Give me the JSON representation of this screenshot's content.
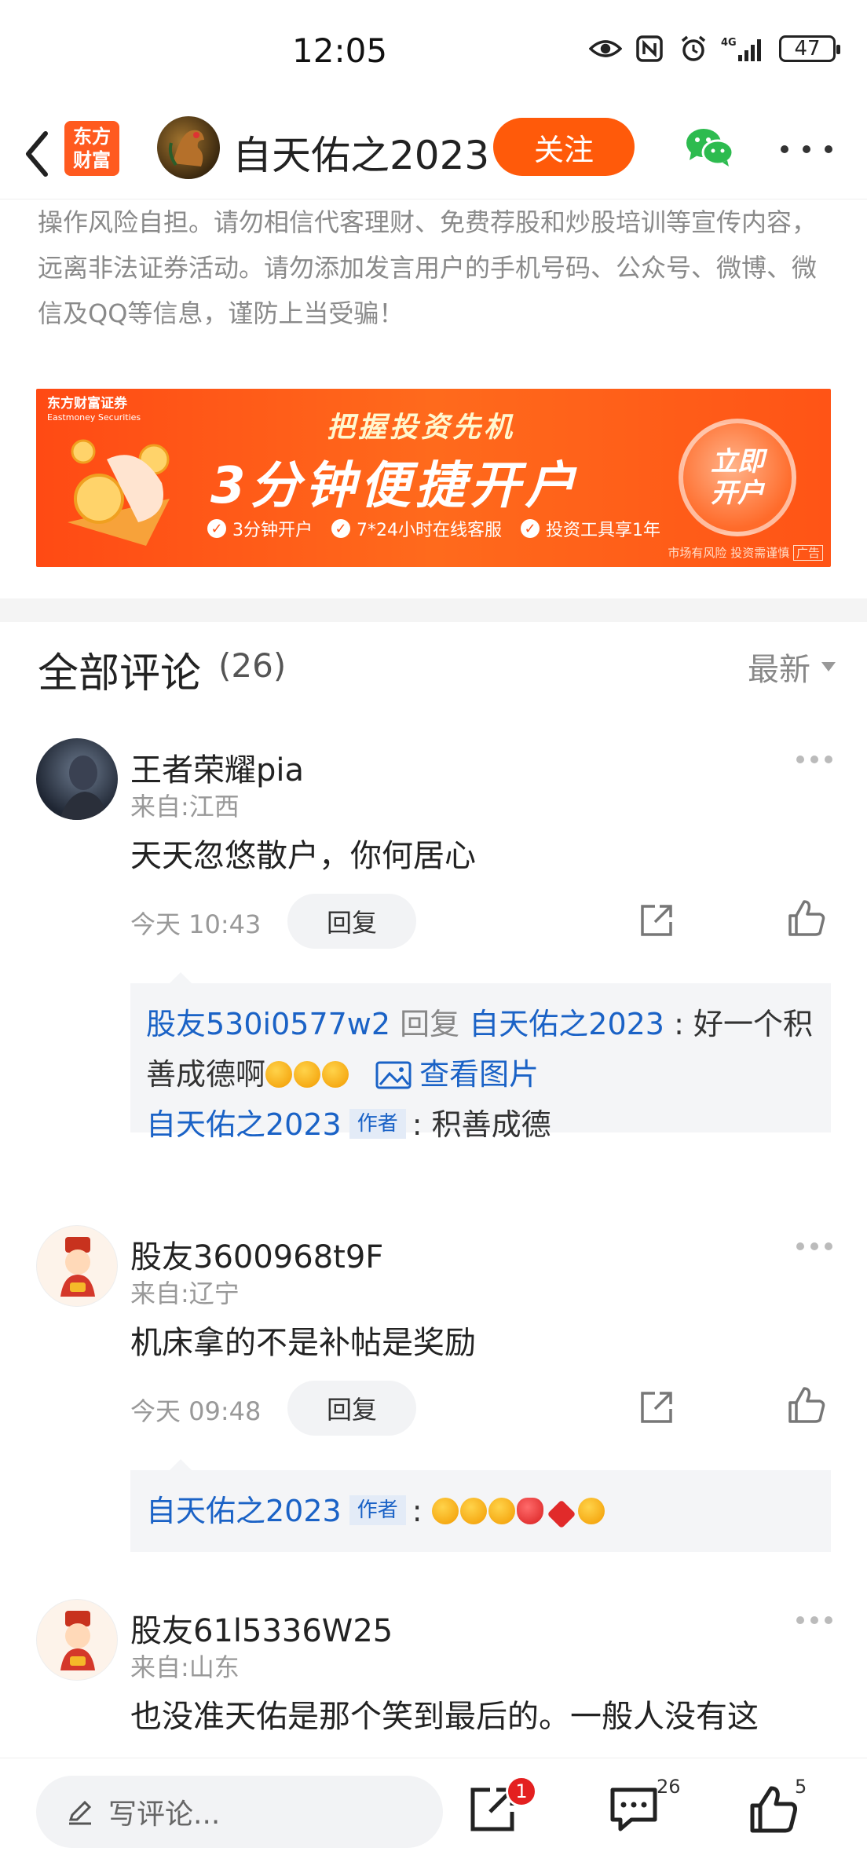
{
  "status_bar": {
    "time": "12:05",
    "network": "4G",
    "battery": "47"
  },
  "header": {
    "brand_logo": "东方\n财富",
    "author_name": "自天佑之2023",
    "follow_label": "关注"
  },
  "disclaimer": "操作风险自担。请勿相信代客理财、免费荐股和炒股培训等宣传内容，远离非法证券活动。请勿添加发言用户的手机号码、公众号、微博、微信及QQ等信息，谨防上当受骗！",
  "banner": {
    "brand": "东方财富证券",
    "brand_en": "Eastmoney Securities",
    "title1": "把握投资先机",
    "title2": "3分钟便捷开户",
    "features": [
      "3分钟开户",
      "7*24小时在线客服",
      "投资工具享1年"
    ],
    "cta": "立即开户",
    "risk": "市场有风险 投资需谨慎",
    "ad": "广告"
  },
  "comments_section": {
    "title": "全部评论",
    "count": "(26)",
    "sort": "最新"
  },
  "comments": [
    {
      "name": "王者荣耀pia",
      "location": "来自:江西",
      "text": "天天忽悠散户，你何居心",
      "time": "今天 10:43",
      "reply_label": "回复",
      "replies": [
        {
          "user": "股友530i0577w2",
          "reply_word": "回复",
          "target": "自天佑之2023",
          "text": "好一个积善成德啊",
          "view_image": "查看图片"
        },
        {
          "user": "自天佑之2023",
          "tag": "作者",
          "text": "积善成德"
        }
      ]
    },
    {
      "name": "股友3600968t9F",
      "location": "来自:辽宁",
      "text": "机床拿的不是补帖是奖励",
      "time": "今天 09:48",
      "reply_label": "回复",
      "replies": [
        {
          "user": "自天佑之2023",
          "tag": "作者",
          "text": ""
        }
      ]
    },
    {
      "name": "股友61l5336W25",
      "location": "来自:山东",
      "text": "也没准天佑是那个笑到最后的。一般人没有这"
    }
  ],
  "bottom_bar": {
    "placeholder": "写评论...",
    "share_badge": "1",
    "comment_count": "26",
    "like_count": "5"
  }
}
